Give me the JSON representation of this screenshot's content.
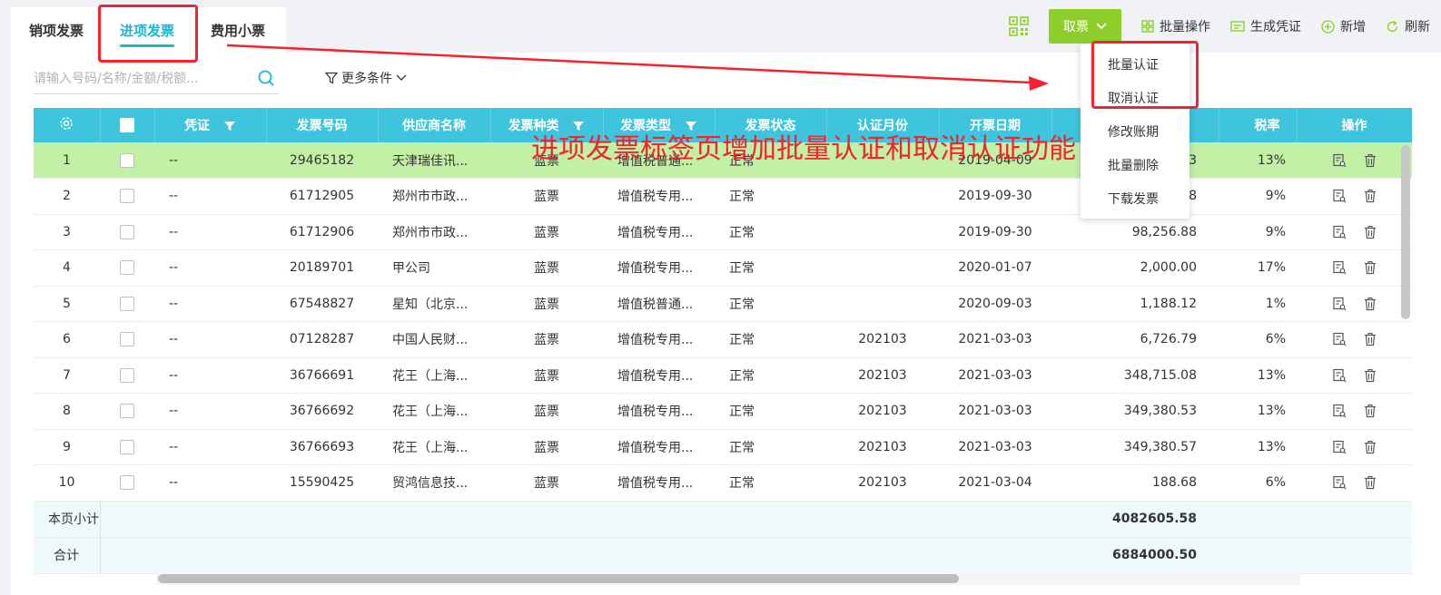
{
  "tabs": [
    {
      "label": "销项发票",
      "active": false
    },
    {
      "label": "进项发票",
      "active": true
    },
    {
      "label": "费用小票",
      "active": false
    }
  ],
  "toolbar": {
    "qr_icon": "qrcode-icon",
    "fetch_label": "取票",
    "batch_label": "批量操作",
    "voucher_label": "生成凭证",
    "add_label": "新增",
    "refresh_label": "刷新",
    "accent_color": "#8ccf2a"
  },
  "search": {
    "placeholder": "请输入号码/名称/金额/税额..."
  },
  "filter": {
    "more_label": "更多条件"
  },
  "dropdown": {
    "items": [
      "批量认证",
      "取消认证",
      "修改账期",
      "批量删除",
      "下载发票"
    ]
  },
  "table": {
    "header_color": "#3ec4dc",
    "highlight_color": "#c2f0a4",
    "columns": [
      "",
      "",
      "凭证",
      "发票号码",
      "供应商名称",
      "发票种类",
      "发票类型",
      "发票状态",
      "认证月份",
      "开票日期",
      "",
      "税率",
      "操作"
    ],
    "rows": [
      {
        "no": "1",
        "voucher": "--",
        "number": "29465182",
        "supplier": "天津瑞佳讯...",
        "kind": "蓝票",
        "type": "增值税普通...",
        "status": "正常",
        "month": "",
        "date": "2019-04-09",
        "amount": "...83",
        "rate": "13%"
      },
      {
        "no": "2",
        "voucher": "--",
        "number": "61712905",
        "supplier": "郑州市市政...",
        "kind": "蓝票",
        "type": "增值税专用...",
        "status": "正常",
        "month": "",
        "date": "2019-09-30",
        "amount": "...88",
        "rate": "9%"
      },
      {
        "no": "3",
        "voucher": "--",
        "number": "61712906",
        "supplier": "郑州市市政...",
        "kind": "蓝票",
        "type": "增值税专用...",
        "status": "正常",
        "month": "",
        "date": "2019-09-30",
        "amount": "98,256.88",
        "rate": "9%"
      },
      {
        "no": "4",
        "voucher": "--",
        "number": "20189701",
        "supplier": "甲公司",
        "kind": "蓝票",
        "type": "增值税专用...",
        "status": "正常",
        "month": "",
        "date": "2020-01-07",
        "amount": "2,000.00",
        "rate": "17%"
      },
      {
        "no": "5",
        "voucher": "--",
        "number": "67548827",
        "supplier": "星知（北京...",
        "kind": "蓝票",
        "type": "增值税普通...",
        "status": "正常",
        "month": "",
        "date": "2020-09-03",
        "amount": "1,188.12",
        "rate": "1%"
      },
      {
        "no": "6",
        "voucher": "--",
        "number": "07128287",
        "supplier": "中国人民财...",
        "kind": "蓝票",
        "type": "增值税专用...",
        "status": "正常",
        "month": "202103",
        "date": "2021-03-03",
        "amount": "6,726.79",
        "rate": "6%"
      },
      {
        "no": "7",
        "voucher": "--",
        "number": "36766691",
        "supplier": "花王（上海...",
        "kind": "蓝票",
        "type": "增值税专用...",
        "status": "正常",
        "month": "202103",
        "date": "2021-03-03",
        "amount": "348,715.08",
        "rate": "13%"
      },
      {
        "no": "8",
        "voucher": "--",
        "number": "36766692",
        "supplier": "花王（上海...",
        "kind": "蓝票",
        "type": "增值税专用...",
        "status": "正常",
        "month": "202103",
        "date": "2021-03-03",
        "amount": "349,380.53",
        "rate": "13%"
      },
      {
        "no": "9",
        "voucher": "--",
        "number": "36766693",
        "supplier": "花王（上海...",
        "kind": "蓝票",
        "type": "增值税专用...",
        "status": "正常",
        "month": "202103",
        "date": "2021-03-03",
        "amount": "349,380.57",
        "rate": "13%"
      },
      {
        "no": "10",
        "voucher": "--",
        "number": "15590425",
        "supplier": "贸鸿信息技...",
        "kind": "蓝票",
        "type": "增值税专用...",
        "status": "正常",
        "month": "202103",
        "date": "2021-03-04",
        "amount": "188.68",
        "rate": "6%"
      }
    ],
    "subtotal_label": "本页小计",
    "subtotal_value": "4082605.58",
    "total_label": "合计",
    "total_value": "6884000.50"
  },
  "annotation": {
    "text": "进项发票标签页增加批量认证和取消认证功能",
    "color": "#f5222d"
  }
}
